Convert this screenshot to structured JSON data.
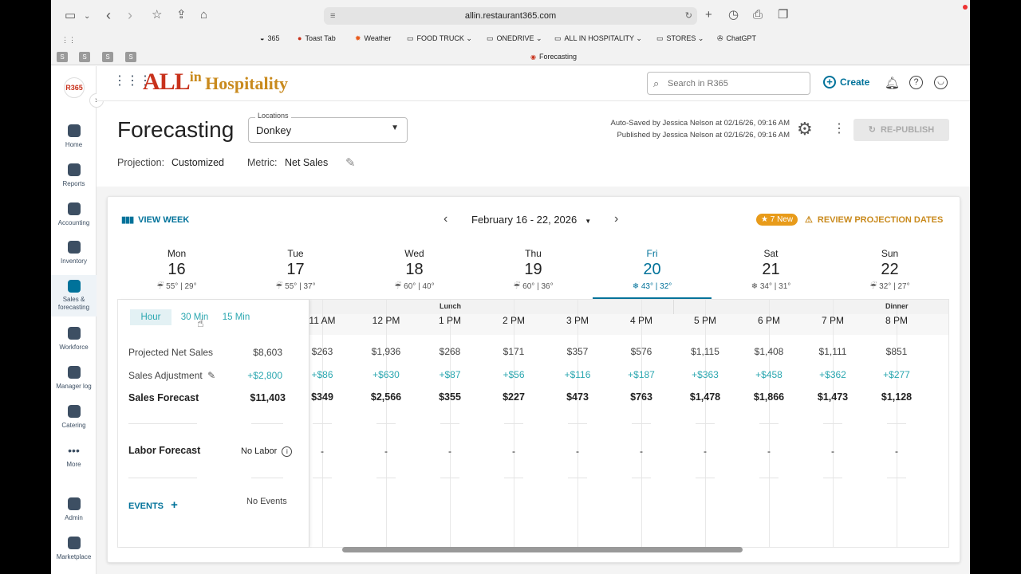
{
  "browser": {
    "url": "allin.restaurant365.com",
    "tab_title": "Forecasting",
    "bookmarks": [
      {
        "icon": "365-icon",
        "label": "365"
      },
      {
        "icon": "toast-icon",
        "label": "Toast Tab"
      },
      {
        "icon": "weather-icon",
        "label": "Weather"
      },
      {
        "icon": "folder-icon",
        "label": "FOOD TRUCK"
      },
      {
        "icon": "folder-icon",
        "label": "ONEDRIVE"
      },
      {
        "icon": "folder-icon",
        "label": "ALL IN HOSPITALITY"
      },
      {
        "icon": "folder-icon",
        "label": "STORES"
      },
      {
        "icon": "chatgpt-icon",
        "label": "ChatGPT"
      }
    ],
    "pinned_tabs": [
      "S",
      "S",
      "S",
      "S"
    ]
  },
  "sidebar": {
    "logo": "R365",
    "items": [
      {
        "icon": "home-icon",
        "label": "Home"
      },
      {
        "icon": "reports-icon",
        "label": "Reports"
      },
      {
        "icon": "accounting-icon",
        "label": "Accounting"
      },
      {
        "icon": "inventory-icon",
        "label": "Inventory"
      },
      {
        "icon": "sales-forecasting-icon",
        "label": "Sales &",
        "label2": "forecasting"
      },
      {
        "icon": "workforce-icon",
        "label": "Workforce"
      },
      {
        "icon": "manager-log-icon",
        "label": "Manager log"
      },
      {
        "icon": "catering-icon",
        "label": "Catering"
      },
      {
        "icon": "more-icon",
        "label": "More"
      },
      {
        "icon": "admin-icon",
        "label": "Admin"
      },
      {
        "icon": "marketplace-icon",
        "label": "Marketplace"
      }
    ]
  },
  "header": {
    "brand_part1": "ALL",
    "brand_part2": "in",
    "brand_part3": "Hospitality",
    "search_placeholder": "Search in R365",
    "create_label": "Create"
  },
  "page": {
    "title": "Forecasting",
    "locations_label": "Locations",
    "location_value": "Donkey",
    "autosaved": "Auto-Saved by Jessica Nelson at 02/16/26, 09:16 AM",
    "published": "Published by Jessica Nelson at 02/16/26, 09:16 AM",
    "republish_label": "RE-PUBLISH",
    "projection_label": "Projection:",
    "projection_value": "Customized",
    "metric_label": "Metric:",
    "metric_value": "Net Sales"
  },
  "toolbar": {
    "view_week": "VIEW WEEK",
    "date_range": "February 16 - 22, 2026",
    "new_badge": "7 New",
    "review": "REVIEW PROJECTION DATES"
  },
  "days": [
    {
      "name": "Mon",
      "date": "16",
      "weather": "55° | 29°",
      "icon": "rain-icon"
    },
    {
      "name": "Tue",
      "date": "17",
      "weather": "55° | 37°",
      "icon": "rain-icon"
    },
    {
      "name": "Wed",
      "date": "18",
      "weather": "60° | 40°",
      "icon": "rain-icon"
    },
    {
      "name": "Thu",
      "date": "19",
      "weather": "60° | 36°",
      "icon": "rain-icon"
    },
    {
      "name": "Fri",
      "date": "20",
      "weather": "43° | 32°",
      "icon": "snow-icon"
    },
    {
      "name": "Sat",
      "date": "21",
      "weather": "34° | 31°",
      "icon": "snow-icon"
    },
    {
      "name": "Sun",
      "date": "22",
      "weather": "32° | 27°",
      "icon": "rain-icon"
    }
  ],
  "interval_tabs": [
    "Hour",
    "30 Min",
    "15 Min"
  ],
  "summary": {
    "projected_label": "Projected Net Sales",
    "projected_value": "$8,603",
    "adjustment_label": "Sales Adjustment",
    "adjustment_value": "+$2,800",
    "forecast_label": "Sales Forecast",
    "forecast_value": "$11,403",
    "labor_label": "Labor Forecast",
    "labor_value": "No Labor",
    "events_label": "EVENTS",
    "events_value": "No Events"
  },
  "grid": {
    "group_lunch": "Lunch",
    "group_dinner": "Dinner",
    "hours": [
      {
        "h": "11 AM",
        "proj": "$263",
        "adj": "+$86",
        "fc": "$349",
        "labor": "-"
      },
      {
        "h": "12 PM",
        "proj": "$1,936",
        "adj": "+$630",
        "fc": "$2,566",
        "labor": "-"
      },
      {
        "h": "1 PM",
        "proj": "$268",
        "adj": "+$87",
        "fc": "$355",
        "labor": "-"
      },
      {
        "h": "2 PM",
        "proj": "$171",
        "adj": "+$56",
        "fc": "$227",
        "labor": "-"
      },
      {
        "h": "3 PM",
        "proj": "$357",
        "adj": "+$116",
        "fc": "$473",
        "labor": "-"
      },
      {
        "h": "4 PM",
        "proj": "$576",
        "adj": "+$187",
        "fc": "$763",
        "labor": "-"
      },
      {
        "h": "5 PM",
        "proj": "$1,115",
        "adj": "+$363",
        "fc": "$1,478",
        "labor": "-"
      },
      {
        "h": "6 PM",
        "proj": "$1,408",
        "adj": "+$458",
        "fc": "$1,866",
        "labor": "-"
      },
      {
        "h": "7 PM",
        "proj": "$1,111",
        "adj": "+$362",
        "fc": "$1,473",
        "labor": "-"
      },
      {
        "h": "8 PM",
        "proj": "$851",
        "adj": "+$277",
        "fc": "$1,128",
        "labor": "-"
      }
    ]
  },
  "colors": {
    "accent": "#00729a",
    "teal_text": "#2ba7b0",
    "brand_red": "#c8321c",
    "brand_gold": "#c98a1d",
    "orange": "#e89b1a"
  }
}
